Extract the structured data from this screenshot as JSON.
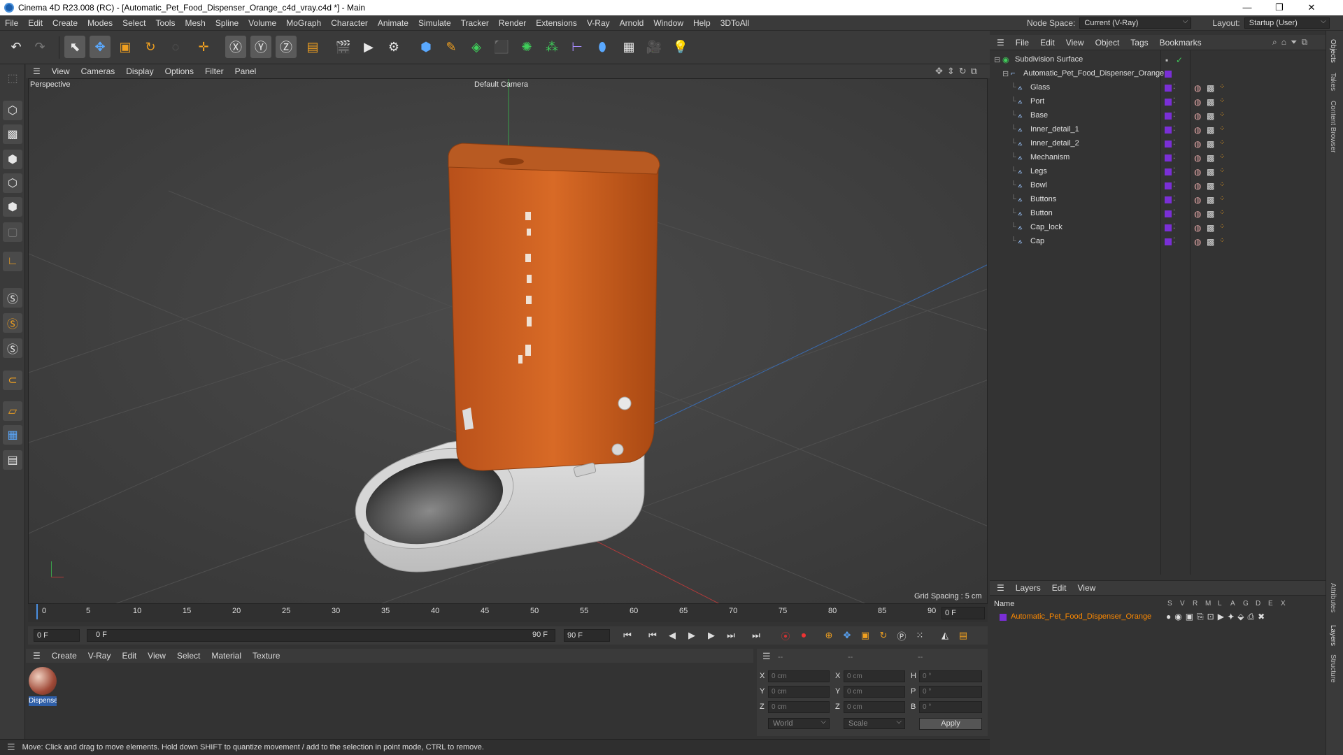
{
  "window": {
    "title": "Cinema 4D R23.008 (RC) - [Automatic_Pet_Food_Dispenser_Orange_c4d_vray.c4d *] - Main",
    "minimize": "—",
    "maximize": "❐",
    "close": "✕"
  },
  "menubar": {
    "items": [
      "File",
      "Edit",
      "Create",
      "Modes",
      "Select",
      "Tools",
      "Mesh",
      "Spline",
      "Volume",
      "MoGraph",
      "Character",
      "Animate",
      "Simulate",
      "Tracker",
      "Render",
      "Extensions",
      "V-Ray",
      "Arnold",
      "Window",
      "Help",
      "3DToAll"
    ],
    "node_space_label": "Node Space:",
    "node_space_value": "Current (V-Ray)",
    "layout_label": "Layout:",
    "layout_value": "Startup (User)"
  },
  "viewport_menu": {
    "items": [
      "View",
      "Cameras",
      "Display",
      "Options",
      "Filter",
      "Panel"
    ]
  },
  "viewport": {
    "view_name": "Perspective",
    "camera": "Default Camera",
    "grid_spacing": "Grid Spacing : 5 cm"
  },
  "timeline": {
    "ticks": [
      "0",
      "5",
      "10",
      "15",
      "20",
      "25",
      "30",
      "35",
      "40",
      "45",
      "50",
      "55",
      "60",
      "65",
      "70",
      "75",
      "80",
      "85",
      "90"
    ],
    "current_frame": "0 F"
  },
  "transport": {
    "start_field": "0 F",
    "range_start": "0 F",
    "range_end": "90 F",
    "end_field": "90 F"
  },
  "material_menu": {
    "items": [
      "Create",
      "V-Ray",
      "Edit",
      "View",
      "Select",
      "Material",
      "Texture"
    ]
  },
  "material": {
    "name": "Dispense"
  },
  "coords": {
    "header": [
      "--",
      "--",
      "--"
    ],
    "pos_labels": [
      "X",
      "Y",
      "Z"
    ],
    "pos_values": [
      "0 cm",
      "0 cm",
      "0 cm"
    ],
    "size_labels": [
      "X",
      "Y",
      "Z"
    ],
    "size_values": [
      "0 cm",
      "0 cm",
      "0 cm"
    ],
    "rot_labels": [
      "H",
      "P",
      "B"
    ],
    "rot_values": [
      "0 °",
      "0 °",
      "0 °"
    ],
    "world": "World",
    "scale": "Scale",
    "apply": "Apply"
  },
  "status": {
    "text": "Move: Click and drag to move elements. Hold down SHIFT to quantize movement / add to the selection in point mode, CTRL to remove."
  },
  "object_menu": {
    "items": [
      "File",
      "Edit",
      "View",
      "Object",
      "Tags",
      "Bookmarks"
    ]
  },
  "objects": {
    "root": "Subdivision Surface",
    "group": "Automatic_Pet_Food_Dispenser_Orange",
    "children": [
      "Glass",
      "Port",
      "Base",
      "Inner_detail_1",
      "Inner_detail_2",
      "Mechanism",
      "Legs",
      "Bowl",
      "Buttons",
      "Button",
      "Cap_lock",
      "Cap"
    ]
  },
  "layer_menu": {
    "items": [
      "Layers",
      "Edit",
      "View"
    ]
  },
  "layers": {
    "header_name": "Name",
    "columns": [
      "S",
      "V",
      "R",
      "M",
      "L",
      "A",
      "G",
      "D",
      "E",
      "X"
    ],
    "rows": [
      {
        "name": "Automatic_Pet_Food_Dispenser_Orange",
        "color": "#7a2fd6"
      }
    ]
  },
  "right_tabs": [
    "Objects",
    "Takes",
    "Content Browser",
    "Attributes",
    "Layers",
    "Structure"
  ],
  "colors": {
    "accent_orange": "#c85a1c",
    "layer_purple": "#7a2fd6",
    "selection_orange": "#ff8a00"
  }
}
